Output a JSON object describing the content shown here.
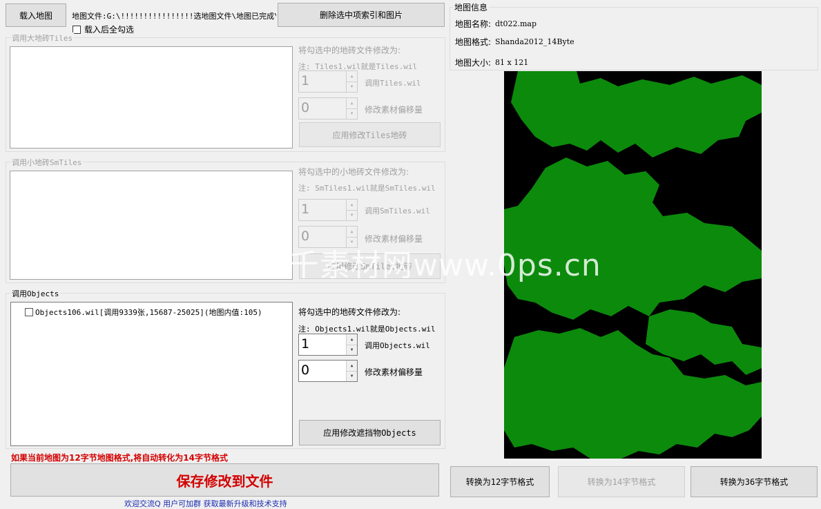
{
  "toolbar": {
    "load_map": "载入地图",
    "map_file_label": "地图文件:G:\\!!!!!!!!!!!!!!!!选地图文件\\地图已完成\\",
    "delete_selected": "删除选中项索引和图片",
    "check_all_after_load": "载入后全勾选"
  },
  "tiles_group": {
    "title": "调用大地砖Tiles",
    "change_to": "将勾选中的地砖文件修改为:",
    "note": "注: Tiles1.wil就是Tiles.wil",
    "value": "1",
    "value_label": "调用Tiles.wil",
    "offset": "0",
    "offset_label": "修改素材偏移量",
    "apply": "应用修改Tiles地砖"
  },
  "smtiles_group": {
    "title": "调用小地砖SmTiles",
    "change_to": "将勾选中的小地砖文件修改为:",
    "note": "注: SmTiles1.wil就是SmTiles.wil",
    "value": "1",
    "value_label": "调用SmTiles.wil",
    "offset": "0",
    "offset_label": "修改素材偏移量",
    "apply": "应用修改SmTiles地砖"
  },
  "objects_group": {
    "title": "调用Objects",
    "items": [
      {
        "label": "Objects106.wil[调用9339张,15687-25025](地图内值:105)"
      }
    ],
    "change_to": "将勾选中的地砖文件修改为:",
    "note": "注: Objects1.wil就是Objects.wil",
    "value": "1",
    "value_label": "调用Objects.wil",
    "offset": "0",
    "offset_label": "修改素材偏移量",
    "apply": "应用修改遮挡物Objects"
  },
  "warning": "如果当前地图为12字节地图格式,将自动转化为14字节格式",
  "save_button": "保存修改到文件",
  "footer_text": "欢迎交流Q  用户可加群  获取最新升级和技术支持",
  "map_info": {
    "title": "地图信息",
    "name_label": "地图名称:",
    "name": "dt022.map",
    "format_label": "地图格式:",
    "format": "Shanda2012_14Byte",
    "size_label": "地图大小:",
    "size": "81 x 121"
  },
  "convert": {
    "to12": "转换为12字节格式",
    "to14": "转换为14字节格式",
    "to36": "转换为36字节格式"
  },
  "colors": {
    "map_land": "#0c8a0c",
    "map_void": "#000000",
    "warning": "#d40000"
  },
  "watermark": "千素材网www.0ps.cn"
}
